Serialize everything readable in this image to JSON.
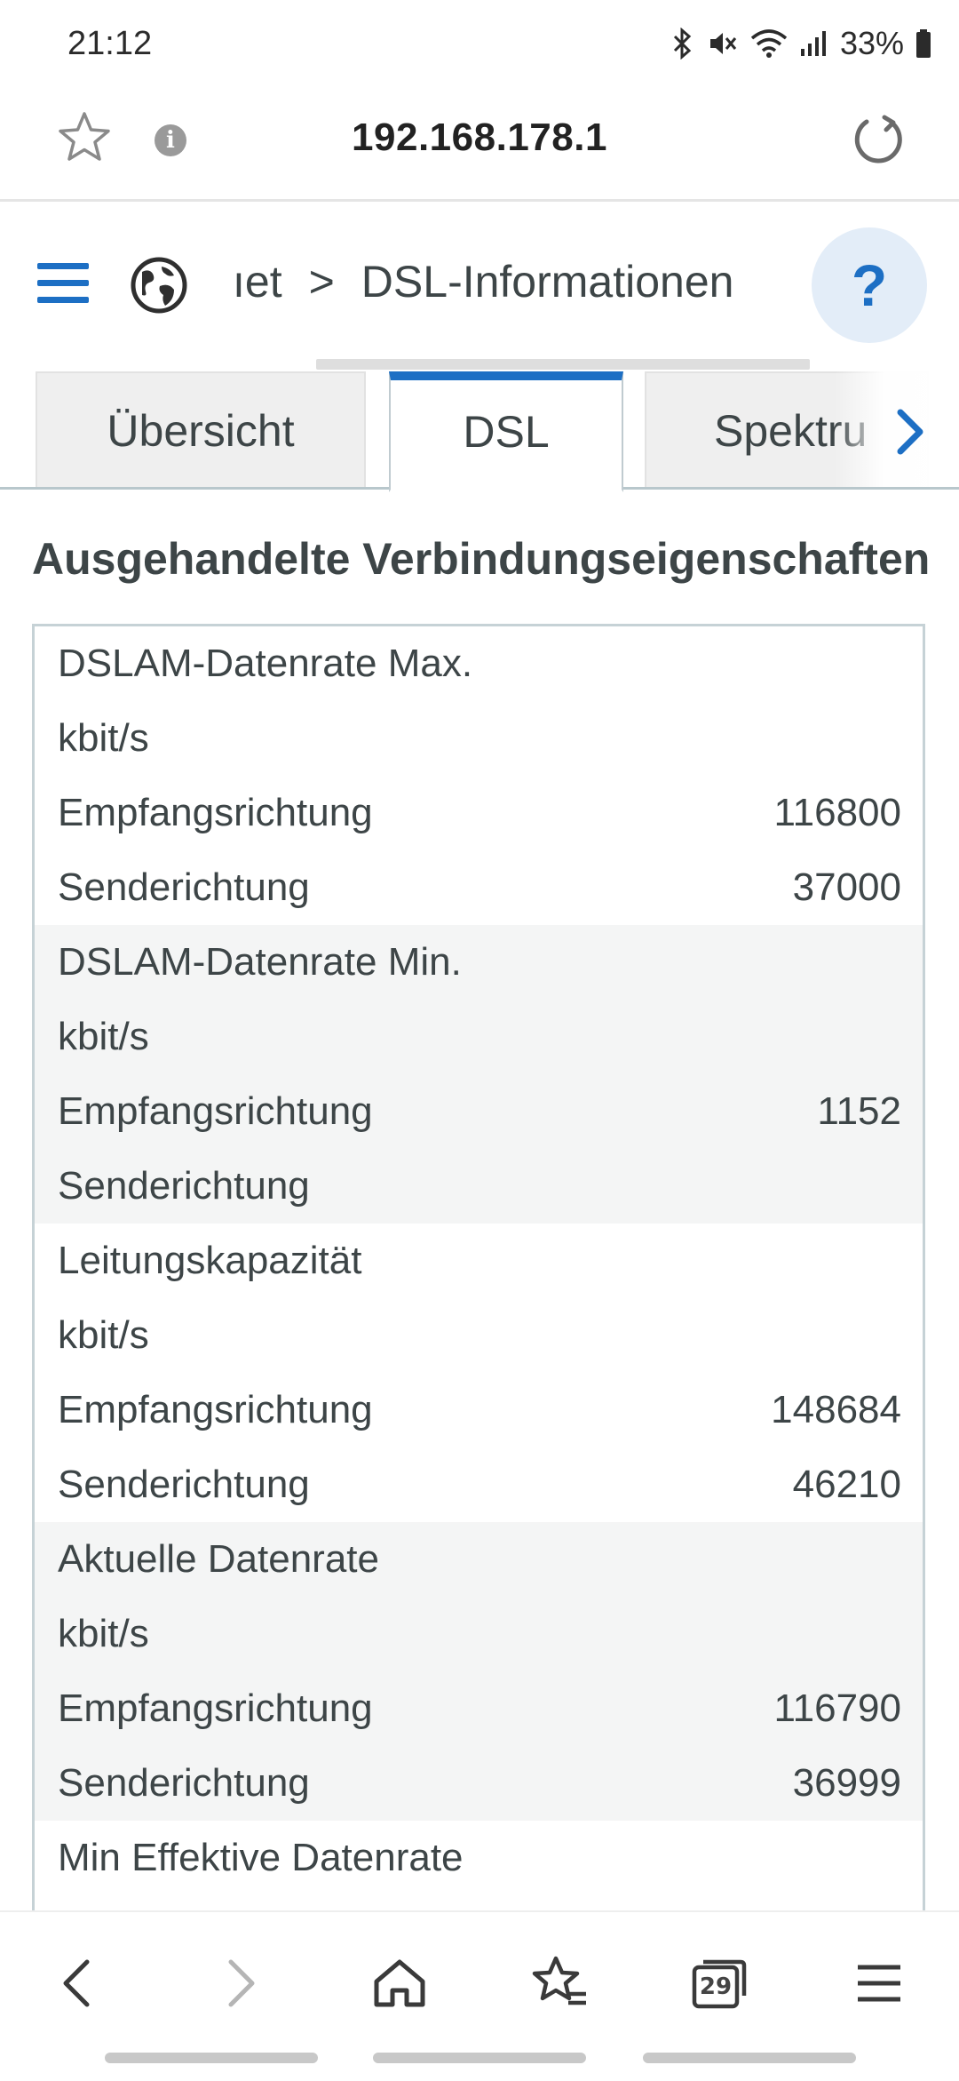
{
  "status": {
    "time": "21:12",
    "battery": "33%",
    "icons": [
      "bluetooth-icon",
      "mute-icon",
      "wifi-icon",
      "signal-icon",
      "battery-icon"
    ]
  },
  "browser": {
    "url": "192.168.178.1",
    "tab_count": "29"
  },
  "nav": {
    "crumb_parent": "ıet",
    "crumb_separator": ">",
    "crumb_current": "DSL-Informationen",
    "help": "?"
  },
  "tabs": [
    {
      "label": "Übersicht"
    },
    {
      "label": "DSL"
    },
    {
      "label": "Spektru"
    }
  ],
  "section_title": "Ausgehandelte Verbindungseigenschaften",
  "groups": [
    {
      "title": "DSLAM-Datenrate Max.",
      "unit": "kbit/s",
      "rows": [
        {
          "label": "Empfangsrichtung",
          "value": "116800"
        },
        {
          "label": "Senderichtung",
          "value": "37000"
        }
      ]
    },
    {
      "title": "DSLAM-Datenrate Min.",
      "unit": "kbit/s",
      "rows": [
        {
          "label": "Empfangsrichtung",
          "value": "1152"
        },
        {
          "label": "Senderichtung",
          "value": ""
        }
      ]
    },
    {
      "title": "Leitungskapazität",
      "unit": "kbit/s",
      "rows": [
        {
          "label": "Empfangsrichtung",
          "value": "148684"
        },
        {
          "label": "Senderichtung",
          "value": "46210"
        }
      ]
    },
    {
      "title": "Aktuelle Datenrate",
      "unit": "kbit/s",
      "rows": [
        {
          "label": "Empfangsrichtung",
          "value": "116790"
        },
        {
          "label": "Senderichtung",
          "value": "36999"
        }
      ]
    },
    {
      "title": "Min Effektive Datenrate"
    }
  ],
  "colors": {
    "accent": "#1d6fc4",
    "text": "#3d4547",
    "shaded_row": "#f4f5f5",
    "border": "#c6d2d6"
  }
}
